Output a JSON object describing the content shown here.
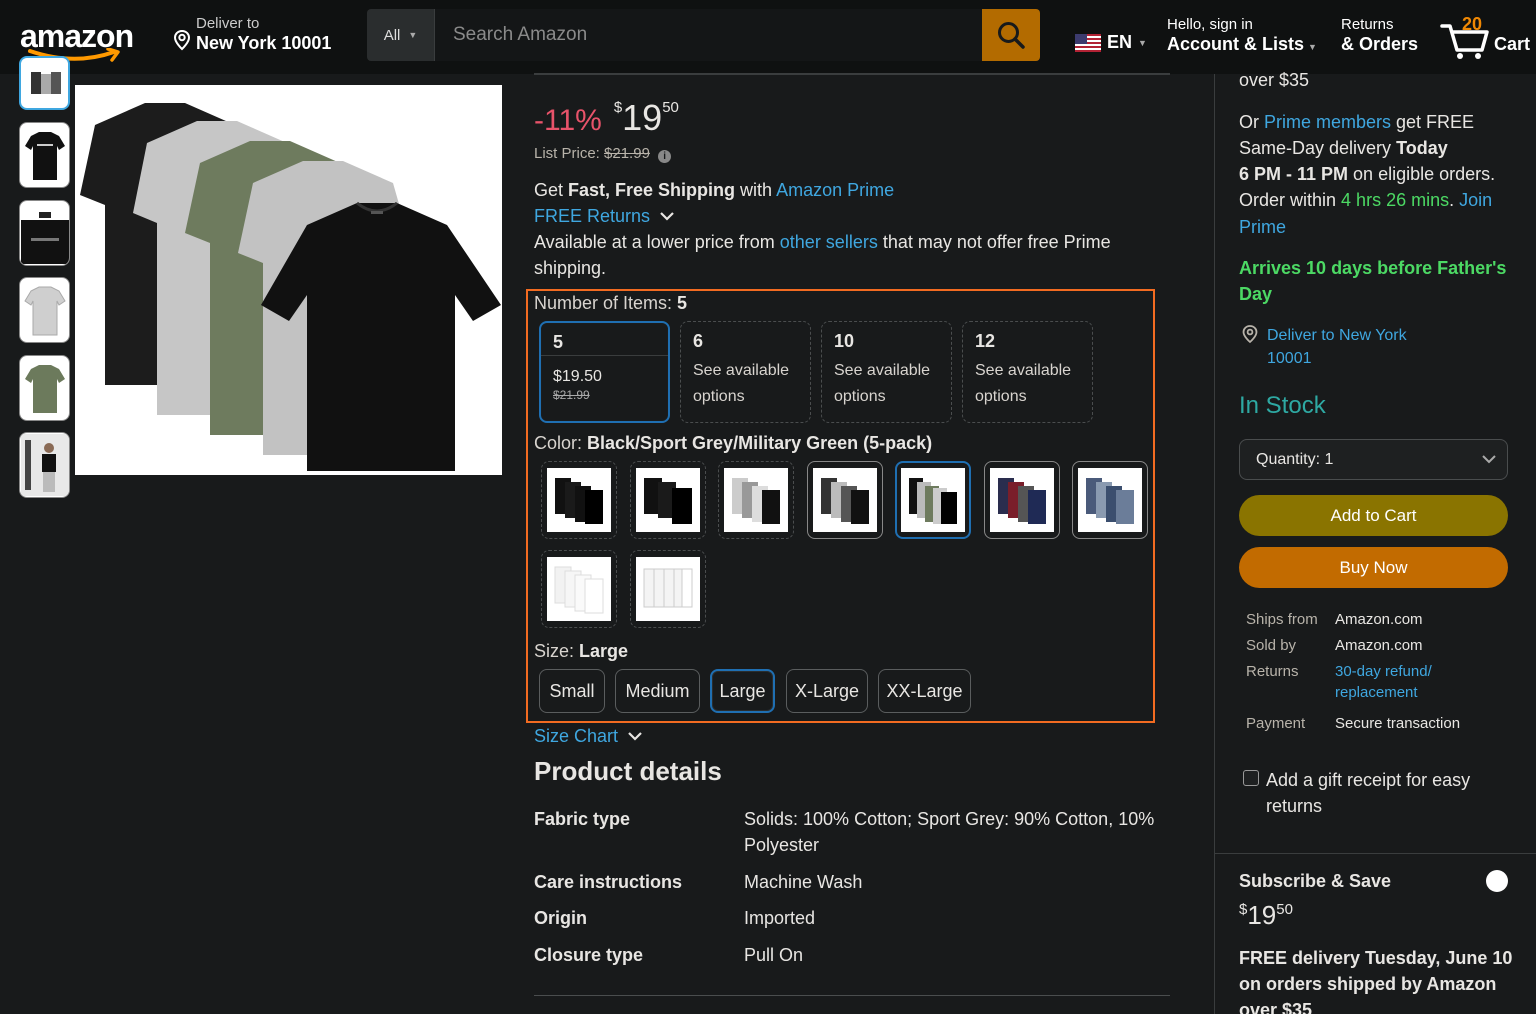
{
  "header": {
    "deliver_line1": "Deliver to",
    "deliver_line2": "New York 10001",
    "search_category": "All",
    "search_placeholder": "Search Amazon",
    "lang": "EN",
    "account_line1": "Hello, sign in",
    "account_line2": "Account & Lists",
    "orders_line1": "Returns",
    "orders_line2": "& Orders",
    "cart_count": "20",
    "cart_label": "Cart",
    "logo_text": "amazon"
  },
  "product": {
    "discount": "-11%",
    "price_symbol": "$",
    "price_whole": "19",
    "price_fraction": "50",
    "list_price_label": "List Price:",
    "list_price": "$21.99",
    "shipping_pre": "Get ",
    "shipping_bold": "Fast, Free Shipping",
    "shipping_mid": " with ",
    "shipping_link": "Amazon Prime",
    "free_returns": "FREE Returns",
    "avail_pre": "Available at a lower price from ",
    "avail_link": "other sellers",
    "avail_post": " that may not offer free Prime shipping."
  },
  "variations": {
    "items_label": "Number of Items: ",
    "items_selected": "5",
    "quantities": [
      {
        "n": "5",
        "price": "$19.50",
        "strike": "$21.99"
      },
      {
        "n": "6",
        "sub": "See available options"
      },
      {
        "n": "10",
        "sub": "See available options"
      },
      {
        "n": "12",
        "sub": "See available options"
      }
    ],
    "color_label": "Color: ",
    "color_selected": "Black/Sport Grey/Military Green (5-pack)",
    "size_label": "Size: ",
    "size_selected": "Large",
    "sizes": [
      "Small",
      "Medium",
      "Large",
      "X-Large",
      "XX-Large"
    ],
    "size_chart": "Size Chart"
  },
  "details": {
    "title": "Product details",
    "rows": [
      {
        "k": "Fabric type",
        "v": "Solids: 100% Cotton; Sport Grey: 90% Cotton, 10% Polyester"
      },
      {
        "k": "Care instructions",
        "v": "Machine Wash"
      },
      {
        "k": "Origin",
        "v": "Imported"
      },
      {
        "k": "Closure type",
        "v": "Pull On"
      }
    ]
  },
  "buybox": {
    "over35": "over $35",
    "prime_pre": "Or ",
    "prime_link": "Prime members",
    "prime_post": " get FREE",
    "sameday_pre": "Same-Day delivery ",
    "sameday_bold": "Today",
    "window_bold": "6 PM - 11 PM",
    "window_post": " on eligible orders.",
    "order_pre": "Order within ",
    "order_time": "4 hrs 26 mins",
    "order_dot": ".",
    "join_link_1": "Join",
    "join_link_2": "Prime",
    "arrives_1": "Arrives 10 days before Father's",
    "arrives_2": "Day",
    "deliver_to_1": "Deliver to New York",
    "deliver_to_2": "10001",
    "in_stock": "In Stock",
    "quantity": "Quantity:  1",
    "add_to_cart": "Add to Cart",
    "buy_now": "Buy Now",
    "ships_from_k": "Ships from",
    "ships_from_v": "Amazon.com",
    "sold_by_k": "Sold by",
    "sold_by_v": "Amazon.com",
    "returns_k": "Returns",
    "returns_v1": "30-day refund/",
    "returns_v2": "replacement",
    "payment_k": "Payment",
    "payment_v": "Secure transaction",
    "gift_1": "Add a gift receipt for easy",
    "gift_2": "returns",
    "subscribe_title": "Subscribe & Save",
    "sub_price_symbol": "$",
    "sub_price_whole": "19",
    "sub_price_fraction": "50",
    "sub_delivery_1": "FREE delivery Tuesday, June 10",
    "sub_delivery_2": "on orders shipped by Amazon",
    "sub_delivery_3": "over $35"
  },
  "colors": {
    "accent_orange": "#f26b21",
    "selected_blue": "#1f6fb2",
    "link_blue": "#3fa7e0",
    "discount_red": "#e8536a",
    "prime_green": "#4cd964",
    "in_stock_teal": "#2ea9a3",
    "add_to_cart": "#8a7400",
    "buy_now": "#c26b00"
  }
}
